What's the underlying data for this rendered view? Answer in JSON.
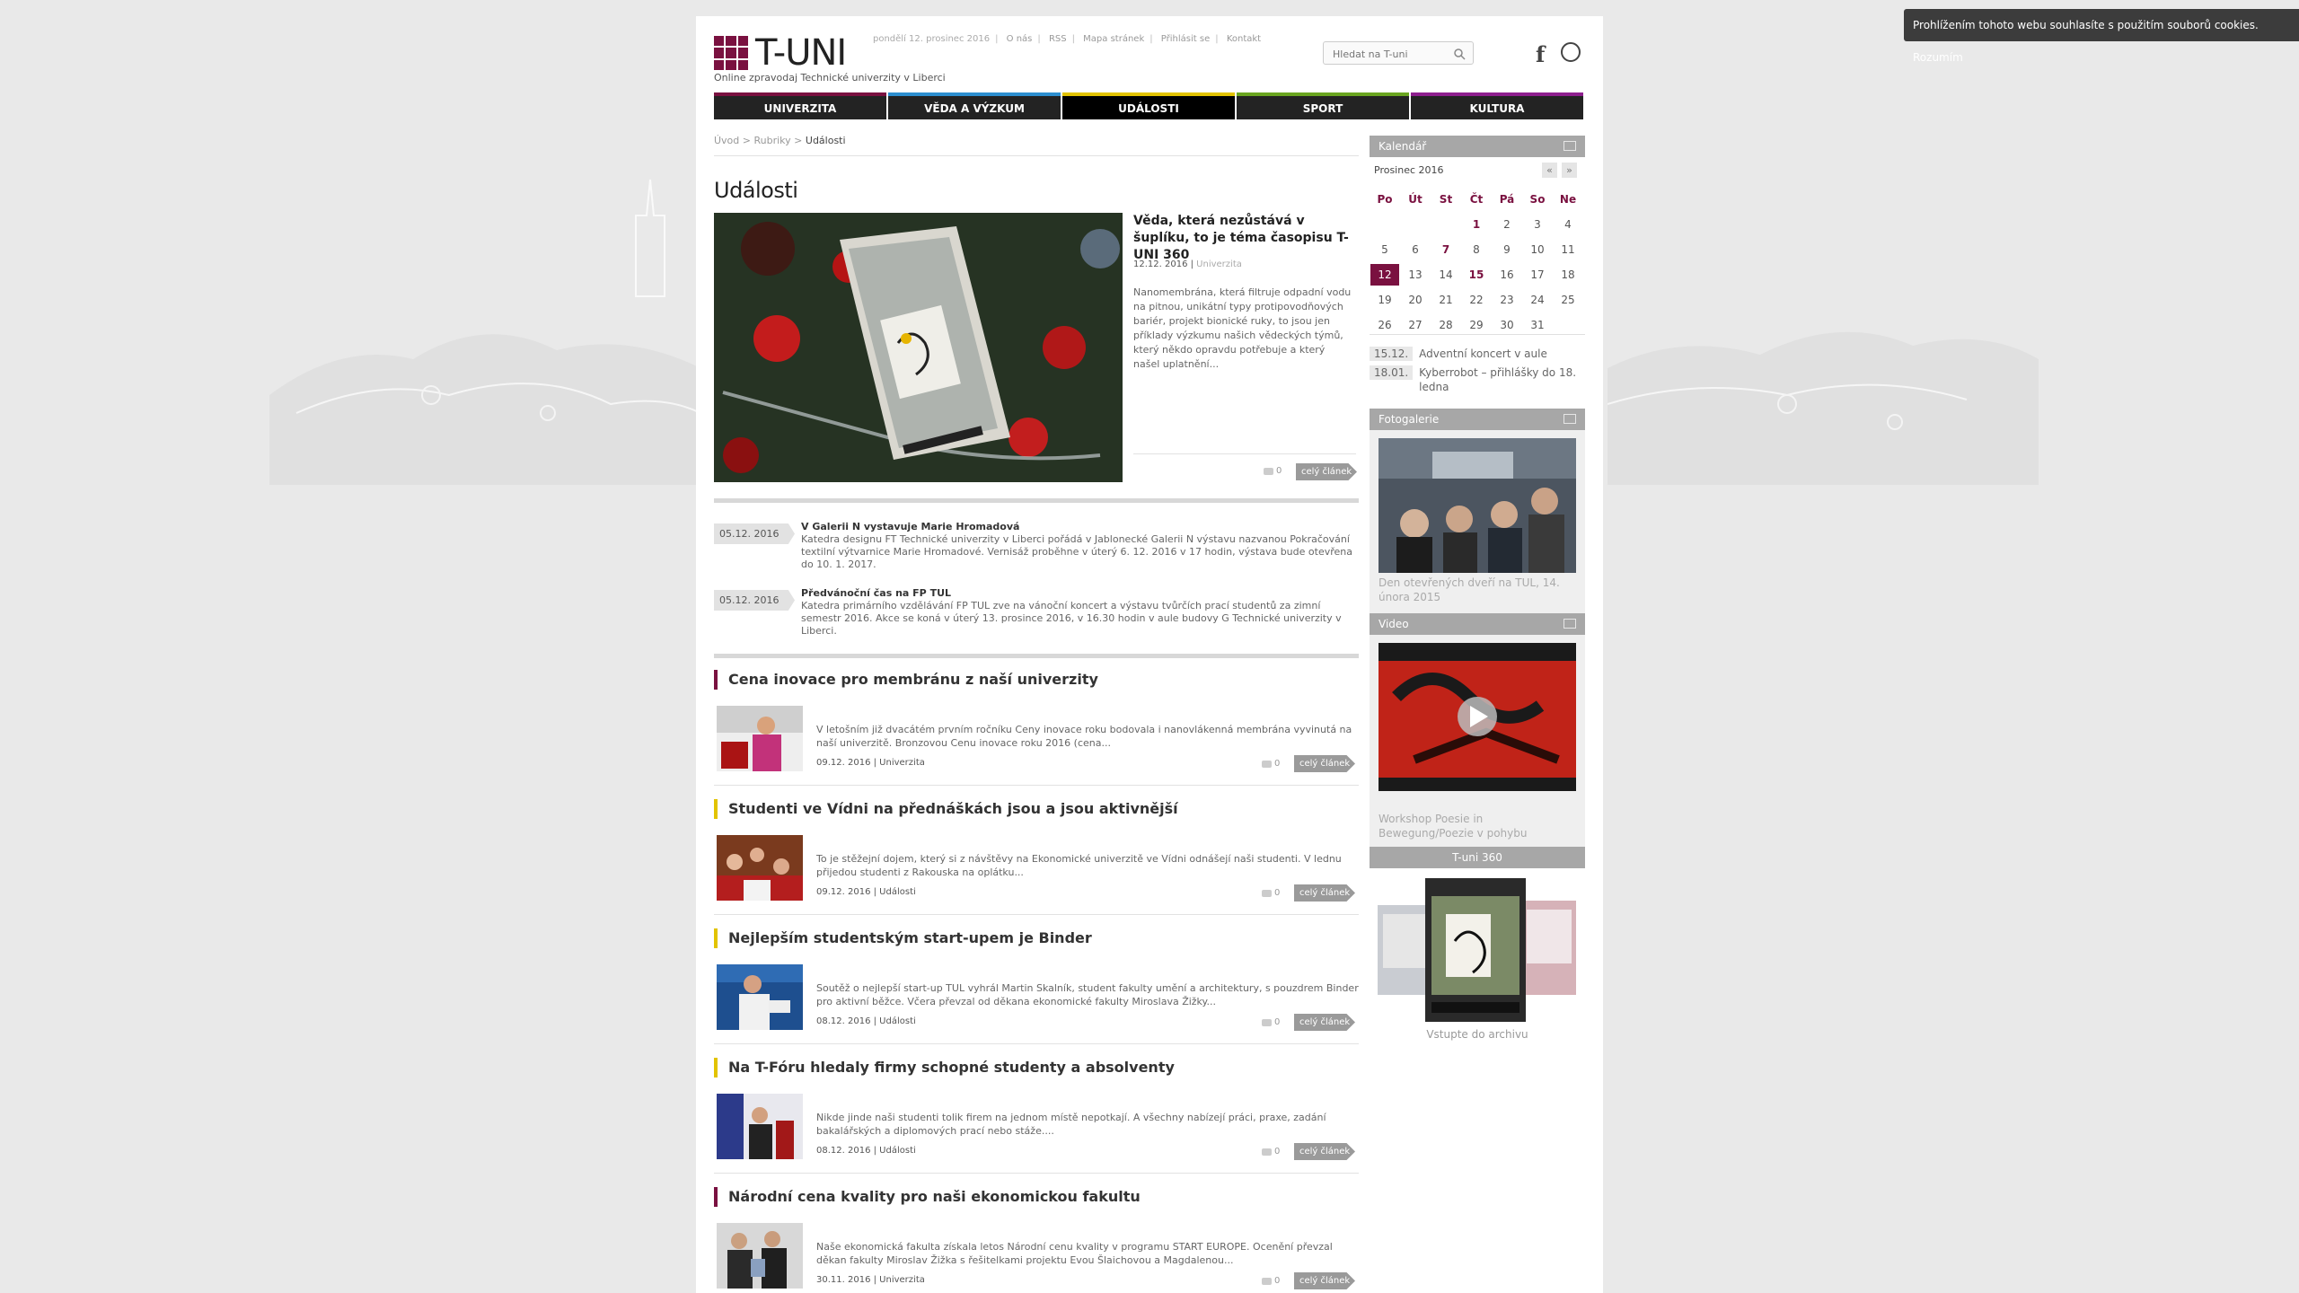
{
  "cookie": {
    "text": "Prohlížením tohoto webu souhlasíte s použitím souborů cookies.",
    "accept": "Rozumím"
  },
  "header": {
    "logo": "T-UNI",
    "tagline": "Online zpravodaj Technické univerzity v Liberci",
    "date": "pondělí 12. prosinec 2016",
    "links": [
      "O nás",
      "RSS",
      "Mapa stránek",
      "Přihlásit se",
      "Kontakt"
    ],
    "search_placeholder": "Hledat na T-uni"
  },
  "nav": [
    {
      "label": "UNIVERZITA",
      "color": "#7a1140"
    },
    {
      "label": "VĚDA A VÝZKUM",
      "color": "#2d8fd0"
    },
    {
      "label": "UDÁLOSTI",
      "color": "#e2c300"
    },
    {
      "label": "SPORT",
      "color": "#6aa520"
    },
    {
      "label": "KULTURA",
      "color": "#8e1f8e"
    }
  ],
  "breadcrumb": {
    "home": "Úvod",
    "section": "Rubriky",
    "current": "Události",
    "sep": ">"
  },
  "page_title": "Události",
  "featured": {
    "title": "Věda, která nezůstává v šuplíku, to je téma časopisu T-UNI 360",
    "date": "12.12. 2016",
    "category": "Univerzita",
    "text": "Nanomembrána, která filtruje odpadní vodu na pitnou, unikátní typy protipovodňových bariér, projekt bionické ruky, to jsou jen příklady výzkumu našich vědeckých týmů, který někdo opravdu potřebuje a který našel uplatnění...",
    "comments": "0",
    "more": "celý článek"
  },
  "events": [
    {
      "date": "05.12. 2016",
      "title": "V Galerii N vystavuje Marie Hromadová",
      "text": "Katedra designu FT Technické univerzity v Liberci pořádá v Jablonecké Galerii N výstavu nazvanou Pokračování textilní výtvarnice Marie Hromadové. Vernisáž proběhne v úterý 6. 12. 2016 v 17 hodin, výstava bude otevřena do 10. 1. 2017."
    },
    {
      "date": "05.12. 2016",
      "title": "Předvánoční čas na FP TUL",
      "text": "Katedra primárního vzdělávání FP TUL  zve na vánoční koncert a výstavu tvůrčích prací studentů za zimní semestr 2016. Akce se koná v úterý 13. prosince 2016, v 16.30 hodin v aule budovy G Technické univerzity v Liberci."
    }
  ],
  "articles": [
    {
      "title": "Cena inovace pro membránu z naší univerzity",
      "accent": "#7a1140",
      "text": "V letošním již dvacátém prvním ročníku Ceny inovace roku bodovala i nanovlákenná membrána vyvinutá na naší univerzitě. Bronzovou Cenu inovace roku 2016 (cena...",
      "date": "09.12. 2016",
      "category": "Univerzita",
      "comments": "0",
      "more": "celý článek"
    },
    {
      "title": "Studenti ve Vídni na přednáškách jsou a jsou aktivnější",
      "accent": "#e2c300",
      "text": "To je stěžejní dojem, který si z návštěvy na Ekonomické univerzitě ve Vídni odnášejí naši studenti. V lednu přijedou studenti z Rakouska na oplátku...",
      "date": "09.12. 2016",
      "category": "Události",
      "comments": "0",
      "more": "celý článek"
    },
    {
      "title": "Nejlepším studentským start-upem je Binder",
      "accent": "#e2c300",
      "text": "Soutěž o nejlepší start-up TUL vyhrál Martin Skalník, student fakulty umění a architektury, s pouzdrem Binder pro aktivní běžce. Včera převzal od děkana ekonomické fakulty Miroslava Žižky...",
      "date": "08.12. 2016",
      "category": "Události",
      "comments": "0",
      "more": "celý článek"
    },
    {
      "title": "Na T-Fóru hledaly firmy schopné studenty a absolventy",
      "accent": "#e2c300",
      "text": "Nikde jinde naši studenti tolik firem na jednom místě nepotkají. A všechny nabízejí práci, praxe, zadání bakalářských a diplomových prací nebo stáže....",
      "date": "08.12. 2016",
      "category": "Události",
      "comments": "0",
      "more": "celý článek"
    },
    {
      "title": "Národní cena kvality pro naši ekonomickou fakultu",
      "accent": "#7a1140",
      "text": "Naše ekonomická fakulta získala letos Národní cenu kvality v programu START EUROPE. Ocenění převzal děkan fakulty Miroslav Žižka s řešitelkami projektu Evou Šlaichovou a Magdalenou...",
      "date": "30.11. 2016",
      "category": "Univerzita",
      "comments": "0",
      "more": "celý článek"
    }
  ],
  "sidebar": {
    "calendar": {
      "title": "Kalendář",
      "month": "Prosinec 2016",
      "prev": "«",
      "next": "»",
      "days": [
        "Po",
        "Út",
        "St",
        "Čt",
        "Pá",
        "So",
        "Ne"
      ],
      "weeks": [
        [
          "",
          "",
          "",
          "1",
          "2",
          "3",
          "4"
        ],
        [
          "5",
          "6",
          "7",
          "8",
          "9",
          "10",
          "11"
        ],
        [
          "12",
          "13",
          "14",
          "15",
          "16",
          "17",
          "18"
        ],
        [
          "19",
          "20",
          "21",
          "22",
          "23",
          "24",
          "25"
        ],
        [
          "26",
          "27",
          "28",
          "29",
          "30",
          "31",
          ""
        ]
      ],
      "event_days": [
        "1",
        "7",
        "15"
      ],
      "today": "12",
      "upcoming": [
        {
          "date": "15.12.",
          "title": "Adventní koncert v aule"
        },
        {
          "date": "18.01.",
          "title": "Kyberrobot – přihlášky do 18. ledna"
        }
      ]
    },
    "gallery": {
      "title": "Fotogalerie",
      "caption": "Den otevřených dveří na TUL, 14. února 2015"
    },
    "video": {
      "title": "Video",
      "caption": "Workshop Poesie in Bewegung/Poezie v pohybu"
    },
    "magazine": {
      "title": "T-uni 360",
      "archive": "Vstupte do archivu"
    }
  }
}
